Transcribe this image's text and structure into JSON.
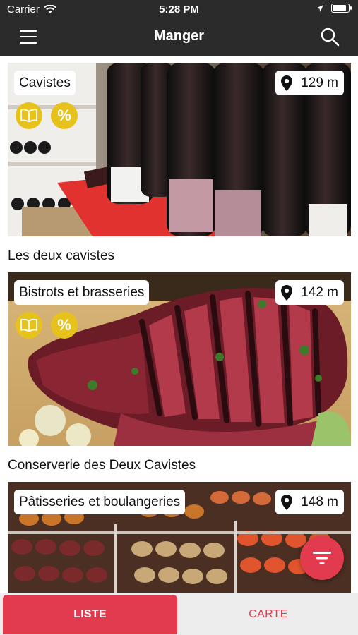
{
  "status_bar": {
    "carrier": "Carrier",
    "time": "5:28 PM",
    "battery_level": 0.8
  },
  "nav": {
    "title": "Manger",
    "menu_icon": "hamburger-menu-icon",
    "search_icon": "search-icon"
  },
  "places": [
    {
      "category": "Cavistes",
      "distance": "129 m",
      "name": "Les deux cavistes",
      "has_guide_badge": true,
      "has_discount_badge": true,
      "discount_symbol": "%"
    },
    {
      "category": "Bistrots et brasseries",
      "distance": "142 m",
      "name": "Conserverie des Deux Cavistes",
      "has_guide_badge": true,
      "has_discount_badge": true,
      "discount_symbol": "%"
    },
    {
      "category": "Pâtisseries et boulangeries",
      "distance": "148 m",
      "name": "",
      "has_guide_badge": false,
      "has_discount_badge": false,
      "discount_symbol": ""
    }
  ],
  "tabs": {
    "list_label": "LISTE",
    "map_label": "CARTE",
    "active": "LISTE"
  },
  "colors": {
    "accent": "#e23a4e",
    "badge": "#e8c21c",
    "nav_bg": "#2b2b2b"
  }
}
